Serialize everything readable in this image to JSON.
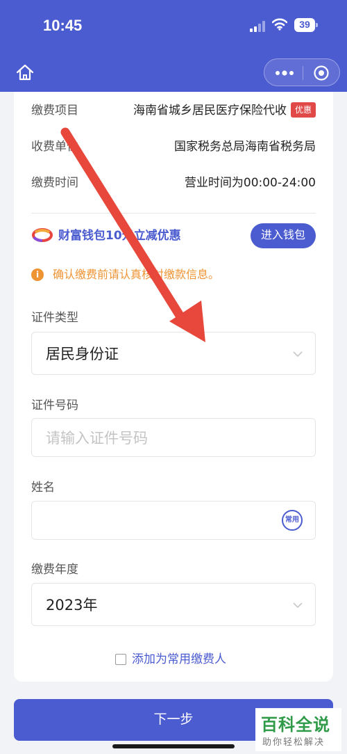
{
  "status_bar": {
    "time": "10:45",
    "battery": "39"
  },
  "info": {
    "item_label": "缴费项目",
    "item_value": "海南省城乡居民医疗保险代收",
    "item_badge": "优惠",
    "payee_label": "收费单位",
    "payee_value": "国家税务总局海南省税务局",
    "time_label": "缴费时间",
    "time_value": "营业时间为00:00-24:00"
  },
  "promo": {
    "text": "财富钱包10元立减优惠",
    "button": "进入钱包"
  },
  "notice": {
    "icon": "i",
    "text": "确认缴费前请认真核对缴款信息。"
  },
  "form": {
    "id_type_label": "证件类型",
    "id_type_value": "居民身份证",
    "id_number_label": "证件号码",
    "id_number_placeholder": "请输入证件号码",
    "name_label": "姓名",
    "name_value": "",
    "common_icon_text": "常用",
    "year_label": "缴费年度",
    "year_value": "2023年",
    "checkbox_label": "添加为常用缴费人"
  },
  "next_button": "下一步",
  "watermark": {
    "title": "百科全说",
    "subtitle": "助你轻松解决"
  },
  "colors": {
    "primary": "#4b5bd0",
    "warning": "#ee9433",
    "badge": "#e14848",
    "arrow": "#e8473b"
  }
}
